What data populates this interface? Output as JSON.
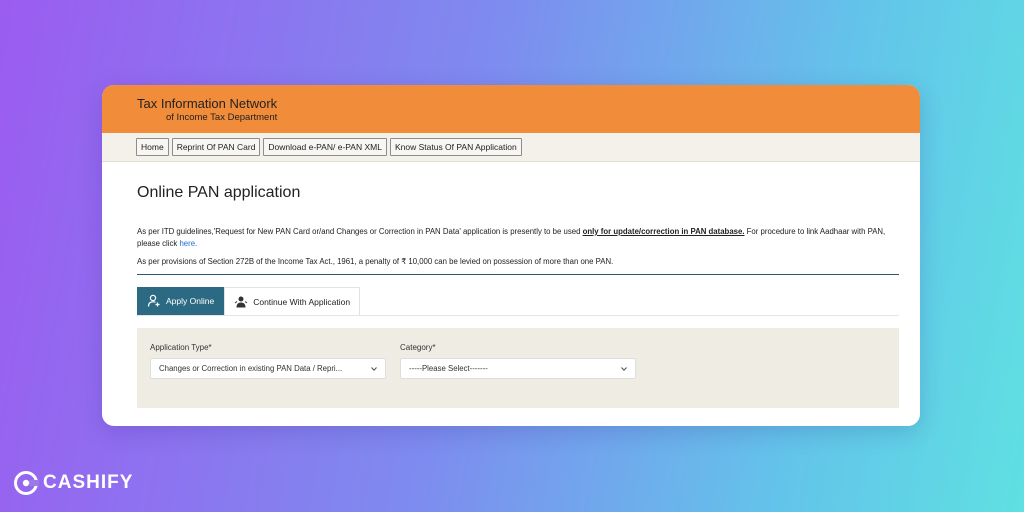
{
  "header": {
    "title": "Tax Information Network",
    "subtitle": "of Income Tax Department"
  },
  "nav": {
    "items": [
      "Home",
      "Reprint Of PAN Card",
      "Download e-PAN/ e-PAN XML",
      "Know Status Of PAN Application"
    ]
  },
  "page": {
    "title": "Online PAN application",
    "para1_prefix": "As per ITD guidelines,'Request for New PAN Card or/and Changes or Correction in PAN Data' application is presently to be used ",
    "para1_emphasis": "only for update/correction in PAN database.",
    "para1_suffix": " For procedure to link Aadhaar with PAN, please click ",
    "para1_link": "here.",
    "para2": "As per provisions of Section 272B of the Income Tax Act., 1961, a penalty of ₹ 10,000 can be levied on possession of more than one PAN."
  },
  "tabs": [
    {
      "label": "Apply Online",
      "active": true,
      "icon": "user-add-icon"
    },
    {
      "label": "Continue With Application",
      "active": false,
      "icon": "person-continue-icon"
    }
  ],
  "form": {
    "application_type_label": "Application Type*",
    "application_type_value": "Changes or Correction in existing PAN Data / Repri...",
    "category_label": "Category*",
    "category_value": "-----Please Select-------"
  },
  "brand": {
    "logo_text": "CASHIFY"
  },
  "colors": {
    "header_orange": "#f08c3a",
    "active_tab": "#2c6a83"
  }
}
